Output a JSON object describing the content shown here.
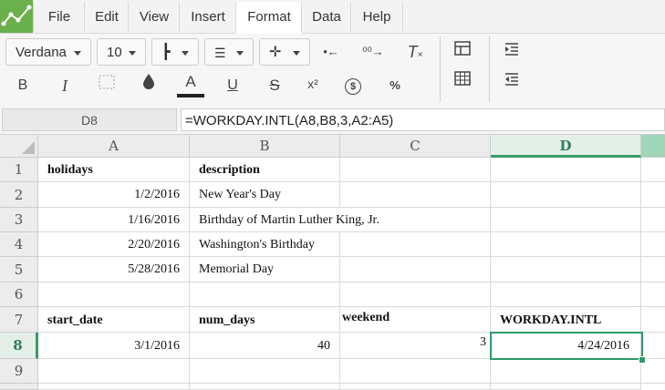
{
  "menu": {
    "items": [
      "File",
      "Edit",
      "View",
      "Insert",
      "Format",
      "Data",
      "Help"
    ],
    "active": "Format"
  },
  "toolbar": {
    "font_family": "Verdana",
    "font_size": "10",
    "icons": [
      "borders-icon",
      "align-icon",
      "valign-icon",
      "decrease-decimal-icon",
      "increase-decimal-icon",
      "clear-format-icon",
      "table-icon",
      "bold-icon",
      "italic-icon",
      "merge-icon",
      "fill-color-icon",
      "text-color-icon",
      "underline-icon",
      "strikethrough-icon",
      "superscript-icon",
      "currency-icon",
      "percent-icon",
      "indent-icon",
      "outdent-icon"
    ],
    "glyphs": {
      "bold": "B",
      "italic": "I",
      "text_color": "A",
      "underline": "U",
      "strike": "S",
      "superscript": "x²",
      "currency": "$",
      "percent": "%"
    }
  },
  "formula_bar": {
    "cell_ref": "D8",
    "formula": "=WORKDAY.INTL(A8,B8,3,A2:A5)"
  },
  "columns": [
    "A",
    "B",
    "C",
    "D"
  ],
  "selected_column": "D",
  "rows": [
    "1",
    "2",
    "3",
    "4",
    "5",
    "6",
    "7",
    "8",
    "9"
  ],
  "selected_row": "8",
  "cells": {
    "r1": {
      "A": "holidays",
      "B": "description"
    },
    "r2": {
      "A": "1/2/2016",
      "B": "New Year's Day"
    },
    "r3": {
      "A": "1/16/2016",
      "B": "Birthday of Martin Luther King, Jr."
    },
    "r4": {
      "A": "2/20/2016",
      "B": "Washington's Birthday"
    },
    "r5": {
      "A": "5/28/2016",
      "B": "Memorial Day"
    },
    "r7": {
      "A": "start_date",
      "B": "num_days",
      "C": "weekend",
      "D": "WORKDAY.INTL"
    },
    "r8": {
      "A": "3/1/2016",
      "B": "40",
      "C": "3",
      "D": "4/24/2016"
    }
  },
  "colors": {
    "accent": "#2e9a6a",
    "logo": "#6ab04c"
  }
}
